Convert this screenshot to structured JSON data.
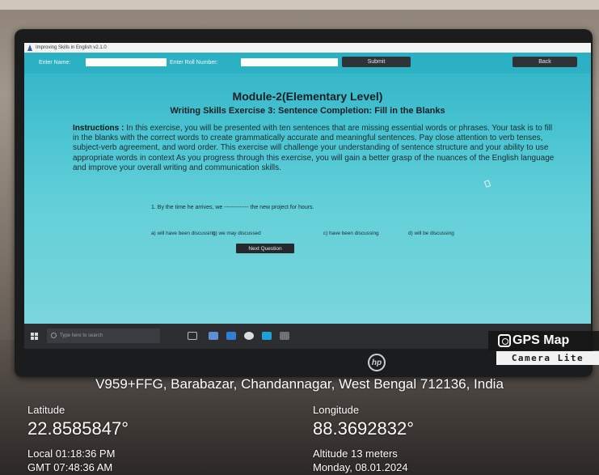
{
  "app": {
    "title": "Improving Skills in English v2.1.0",
    "enter_name_label": "Enter Name:",
    "enter_roll_label": "Enter Roll Number:",
    "submit_label": "Submit",
    "back_label": "Back",
    "name_value": "",
    "roll_value": ""
  },
  "content": {
    "module_title": "Module-2(Elementary Level)",
    "exercise_title": "Writing Skills Exercise 3: Sentence Completion: Fill in the Blanks",
    "instructions_label": "Instructions :",
    "instructions_text": " In this exercise, you will be presented with ten sentences that are missing essential words or phrases. Your task is to fill in the blanks with the correct words to create grammatically accurate and meaningful sentences. Pay close attention to verb tenses, subject-verb agreement, and word order. This exercise will challenge your understanding of sentence structure and your ability to use appropriate words in context As you progress through this exercise, you will gain a better grasp of the nuances of the English language and improve your overall writing and communication skills.",
    "question": "1. By the time he arrives, we ------------- the new project for hours.",
    "options": [
      "a) will have been discussing",
      "b) we may discussed",
      "c) have been discussing",
      "d) will be discussing"
    ],
    "next_label": "Next Question"
  },
  "taskbar": {
    "search_placeholder": "Type here to search"
  },
  "overlay": {
    "badge_title": "GPS Map",
    "badge_subtitle": "Camera Lite",
    "address": "V959+FFG, Barabazar, Chandannagar, West Bengal 712136, India",
    "latitude_label": "Latitude",
    "latitude_value": "22.8585847°",
    "longitude_label": "Longitude",
    "longitude_value": "88.3692832°",
    "local_time": "Local 01:18:36 PM",
    "gmt_time": "GMT 07:48:36 AM",
    "altitude": "Altitude 13 meters",
    "date": "Monday, 08.01.2024"
  },
  "monitor": {
    "brand_logo": "hp"
  }
}
